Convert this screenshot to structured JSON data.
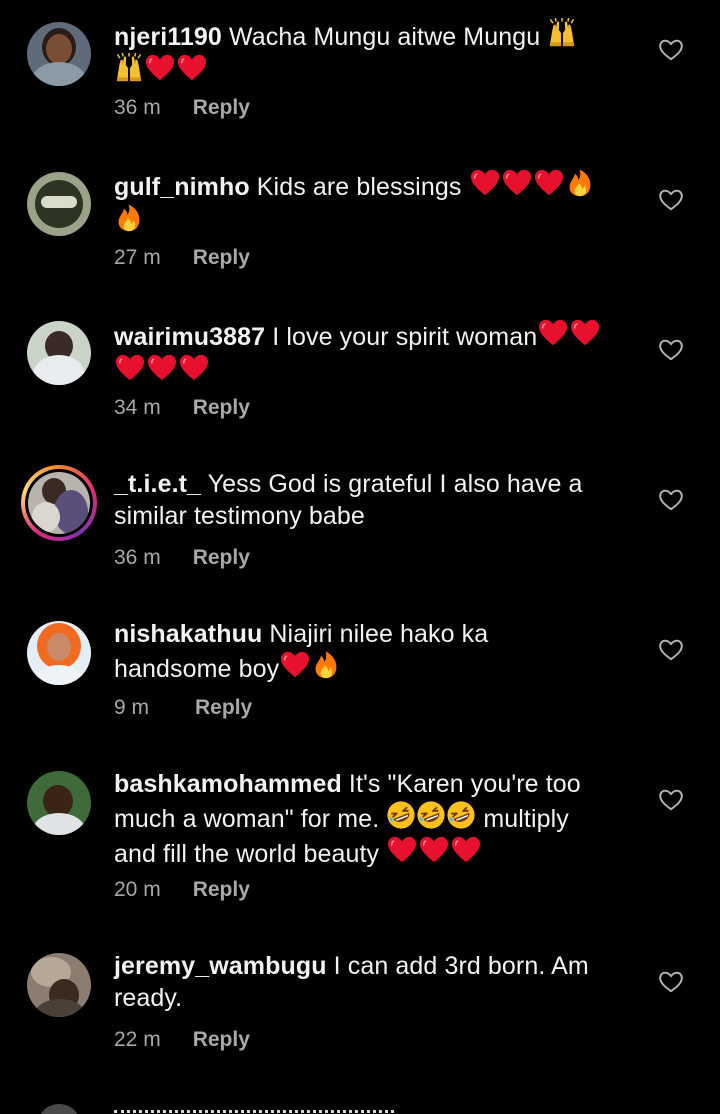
{
  "comments": [
    {
      "username": "njeri1190",
      "text": " Wacha Mungu aitwe Mungu ",
      "time": "36 m",
      "reply": "Reply",
      "emojis_inline": [
        "raised-hands"
      ],
      "emojis_line2": [
        "raised-hands",
        "red-heart",
        "red-heart"
      ]
    },
    {
      "username": "gulf_nimho",
      "text": " Kids are blessings ",
      "time": "27 m",
      "reply": "Reply",
      "emojis_inline": [
        "red-heart",
        "red-heart",
        "red-heart",
        "fire"
      ],
      "emojis_line2": [
        "fire"
      ]
    },
    {
      "username": "wairimu3887",
      "text": " I love your spirit woman",
      "time": "34 m",
      "reply": "Reply",
      "emojis_inline": [
        "red-heart",
        "red-heart"
      ],
      "emojis_line2": [
        "red-heart",
        "red-heart",
        "red-heart"
      ]
    },
    {
      "username": "_t.i.e.t_",
      "text": " Yess God is grateful I also have a",
      "text_line2": "similar testimony babe",
      "time": "36 m",
      "reply": "Reply"
    },
    {
      "username": "nishakathuu",
      "text": " Niajiri nilee hako ka",
      "text_line2": "handsome boy",
      "time": "9 m",
      "reply": "Reply",
      "emojis_line2": [
        "red-heart",
        "fire"
      ]
    },
    {
      "username": "bashkamohammed",
      "text": " It's \"Karen you're too",
      "text_line2": "much a woman\" for me. ",
      "text_line2_after": " multiply",
      "text_line3": "and fill the world beauty ",
      "time": "20 m",
      "reply": "Reply",
      "emojis_line2": [
        "rofl",
        "rofl",
        "rofl"
      ],
      "emojis_line3": [
        "red-heart",
        "red-heart",
        "red-heart"
      ]
    },
    {
      "username": "jeremy_wambugu",
      "text": " I can add 3rd born. Am",
      "text_line2": "ready.",
      "time": "22 m",
      "reply": "Reply"
    }
  ],
  "colors": {
    "background": "#000000",
    "text": "#f2f2f2",
    "meta": "#a8a8a8",
    "heart_emoji": "#e8112d",
    "fire_emoji": "#ff8a00",
    "story_ring": [
      "#f58529",
      "#dd2a7b",
      "#8134af"
    ]
  },
  "icons": {
    "like": "heart-outline-icon"
  }
}
